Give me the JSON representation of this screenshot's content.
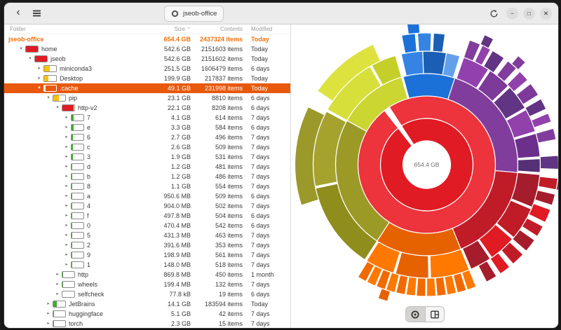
{
  "window": {
    "title": "jseob-office",
    "controls": {
      "back_icon": "‹",
      "minimize_icon": "−",
      "maximize_icon": "□",
      "close_icon": "✕"
    }
  },
  "colors": {
    "selection": "#e8590c",
    "root_text": "#f77009",
    "bar_red": "#e01b24",
    "bar_yellow": "#f5c211",
    "bar_green": "#44a832",
    "bar_white": "#ffffff"
  },
  "tree": {
    "columns": [
      "Folder",
      "Size",
      "Contents",
      "Modified"
    ],
    "sort_caret": "⌃",
    "expander_icons": {
      "open": "▾",
      "closed": "▸",
      "none": ""
    },
    "rows": [
      {
        "name": "jseob-office",
        "level": 0,
        "exp": "none",
        "bar": null,
        "root": true,
        "size": "654.4 GB",
        "contents": "2437324 items",
        "modified": "Today"
      },
      {
        "name": "home",
        "level": 1,
        "exp": "open",
        "bar": {
          "pct": 100,
          "color": "red"
        },
        "size": "542.6 GB",
        "contents": "2151603 items",
        "modified": "Today"
      },
      {
        "name": "jseob",
        "level": 2,
        "exp": "open",
        "bar": {
          "pct": 100,
          "color": "red"
        },
        "size": "542.6 GB",
        "contents": "2151602 items",
        "modified": "Today"
      },
      {
        "name": "miniconda3",
        "level": 3,
        "exp": "closed",
        "bar": {
          "pct": 46,
          "color": "yellow"
        },
        "size": "251.5 GB",
        "contents": "1606479 items",
        "modified": "6 days"
      },
      {
        "name": "Desktop",
        "level": 3,
        "exp": "closed",
        "bar": {
          "pct": 37,
          "color": "yellow"
        },
        "size": "199.9 GB",
        "contents": "217837 items",
        "modified": "Today"
      },
      {
        "name": ".cache",
        "level": 3,
        "exp": "open",
        "bar": {
          "pct": 9,
          "color": "white"
        },
        "sel": true,
        "size": "49.1 GB",
        "contents": "231998 items",
        "modified": "Today"
      },
      {
        "name": "pip",
        "level": 4,
        "exp": "open",
        "bar": {
          "pct": 47,
          "color": "yellow"
        },
        "size": "23.1 GB",
        "contents": "8810 items",
        "modified": "6 days"
      },
      {
        "name": "http-v2",
        "level": 5,
        "exp": "open",
        "bar": {
          "pct": 96,
          "color": "red"
        },
        "size": "22.1 GB",
        "contents": "8208 items",
        "modified": "6 days"
      },
      {
        "name": "7",
        "level": 6,
        "exp": "closed",
        "bar": {
          "pct": 19,
          "color": "green"
        },
        "size": "4.1 GB",
        "contents": "614 items",
        "modified": "7 days"
      },
      {
        "name": "e",
        "level": 6,
        "exp": "closed",
        "bar": {
          "pct": 15,
          "color": "green"
        },
        "size": "3.3 GB",
        "contents": "584 items",
        "modified": "6 days"
      },
      {
        "name": "6",
        "level": 6,
        "exp": "closed",
        "bar": {
          "pct": 12,
          "color": "green"
        },
        "size": "2.7 GB",
        "contents": "496 items",
        "modified": "7 days"
      },
      {
        "name": "c",
        "level": 6,
        "exp": "closed",
        "bar": {
          "pct": 12,
          "color": "green"
        },
        "size": "2.6 GB",
        "contents": "509 items",
        "modified": "7 days"
      },
      {
        "name": "3",
        "level": 6,
        "exp": "closed",
        "bar": {
          "pct": 9,
          "color": "green"
        },
        "size": "1.9 GB",
        "contents": "531 items",
        "modified": "7 days"
      },
      {
        "name": "d",
        "level": 6,
        "exp": "closed",
        "bar": {
          "pct": 5,
          "color": "green"
        },
        "size": "1.2 GB",
        "contents": "481 items",
        "modified": "7 days"
      },
      {
        "name": "b",
        "level": 6,
        "exp": "closed",
        "bar": {
          "pct": 5,
          "color": "green"
        },
        "size": "1.2 GB",
        "contents": "486 items",
        "modified": "7 days"
      },
      {
        "name": "8",
        "level": 6,
        "exp": "closed",
        "bar": {
          "pct": 5,
          "color": "green"
        },
        "size": "1.1 GB",
        "contents": "554 items",
        "modified": "7 days"
      },
      {
        "name": "a",
        "level": 6,
        "exp": "closed",
        "bar": {
          "pct": 4,
          "color": "green"
        },
        "size": "950.6 MB",
        "contents": "509 items",
        "modified": "6 days"
      },
      {
        "name": "4",
        "level": 6,
        "exp": "closed",
        "bar": {
          "pct": 4,
          "color": "green"
        },
        "size": "904.0 MB",
        "contents": "502 items",
        "modified": "7 days"
      },
      {
        "name": "f",
        "level": 6,
        "exp": "closed",
        "bar": {
          "pct": 2,
          "color": "green"
        },
        "size": "497.8 MB",
        "contents": "504 items",
        "modified": "6 days"
      },
      {
        "name": "0",
        "level": 6,
        "exp": "closed",
        "bar": {
          "pct": 2,
          "color": "green"
        },
        "size": "470.4 MB",
        "contents": "542 items",
        "modified": "6 days"
      },
      {
        "name": "5",
        "level": 6,
        "exp": "closed",
        "bar": {
          "pct": 2,
          "color": "green"
        },
        "size": "431.3 MB",
        "contents": "463 items",
        "modified": "7 days"
      },
      {
        "name": "2",
        "level": 6,
        "exp": "closed",
        "bar": {
          "pct": 2,
          "color": "green"
        },
        "size": "391.6 MB",
        "contents": "353 items",
        "modified": "7 days"
      },
      {
        "name": "9",
        "level": 6,
        "exp": "closed",
        "bar": {
          "pct": 1,
          "color": "green"
        },
        "size": "198.9 MB",
        "contents": "561 items",
        "modified": "7 days"
      },
      {
        "name": "1",
        "level": 6,
        "exp": "closed",
        "bar": {
          "pct": 1,
          "color": "green"
        },
        "size": "148.0 MB",
        "contents": "518 items",
        "modified": "7 days"
      },
      {
        "name": "http",
        "level": 5,
        "exp": "closed",
        "bar": {
          "pct": 4,
          "color": "green"
        },
        "size": "869.8 MB",
        "contents": "450 items",
        "modified": "1 month"
      },
      {
        "name": "wheels",
        "level": 5,
        "exp": "closed",
        "bar": {
          "pct": 1,
          "color": "green"
        },
        "size": "199.4 MB",
        "contents": "132 items",
        "modified": "7 days"
      },
      {
        "name": "selfcheck",
        "level": 5,
        "exp": "closed",
        "bar": {
          "pct": 0,
          "color": "green"
        },
        "size": "77.8 kB",
        "contents": "19 items",
        "modified": "6 days"
      },
      {
        "name": "JetBrains",
        "level": 4,
        "exp": "closed",
        "bar": {
          "pct": 30,
          "color": "green"
        },
        "size": "14.1 GB",
        "contents": "183594 items",
        "modified": "Today"
      },
      {
        "name": "huggingface",
        "level": 4,
        "exp": "closed",
        "bar": {
          "pct": 1,
          "color": "green"
        },
        "size": "5.1 GB",
        "contents": "42 items",
        "modified": "7 days"
      },
      {
        "name": "torch",
        "level": 4,
        "exp": "closed",
        "bar": {
          "pct": 1,
          "color": "green"
        },
        "size": "2.3 GB",
        "contents": "15 items",
        "modified": "7 days"
      }
    ]
  },
  "chart": {
    "type": "sunburst",
    "center_label": "654.4 GB",
    "arcs": [
      {
        "r": 1,
        "s": 327,
        "e": 682,
        "c": "#e01b24"
      },
      {
        "r": 2,
        "s": 327,
        "e": 682,
        "c": "#ed333b"
      },
      {
        "r": 3,
        "s": 345,
        "e": 378,
        "c": "#1c71d8"
      },
      {
        "r": 3,
        "s": 18,
        "e": 95,
        "c": "#813d9c"
      },
      {
        "r": 3,
        "s": 95,
        "e": 158,
        "c": "#c01c28"
      },
      {
        "r": 3,
        "s": 158,
        "e": 213,
        "c": "#e66100"
      },
      {
        "r": 3,
        "s": 213,
        "e": 299,
        "c": "#9c9a26"
      },
      {
        "r": 3,
        "s": 299,
        "e": 344,
        "c": "#ccd633"
      },
      {
        "r": 4,
        "s": 347,
        "e": 358,
        "c": "#3584e4"
      },
      {
        "r": 4,
        "s": 358,
        "e": 370,
        "c": "#1a5fb4"
      },
      {
        "r": 4,
        "s": 10,
        "e": 17,
        "c": "#62a0ea"
      },
      {
        "r": 4,
        "s": 19,
        "e": 33,
        "c": "#9141ac"
      },
      {
        "r": 4,
        "s": 34,
        "e": 46,
        "c": "#7d3a99"
      },
      {
        "r": 4,
        "s": 47,
        "e": 60,
        "c": "#613583"
      },
      {
        "r": 4,
        "s": 61,
        "e": 73,
        "c": "#9141ac"
      },
      {
        "r": 4,
        "s": 74,
        "e": 86,
        "c": "#6d2f8c"
      },
      {
        "r": 4,
        "s": 87,
        "e": 94,
        "c": "#553077"
      },
      {
        "r": 4,
        "s": 95,
        "e": 112,
        "c": "#a51d2d"
      },
      {
        "r": 4,
        "s": 113,
        "e": 130,
        "c": "#c01c28"
      },
      {
        "r": 4,
        "s": 131,
        "e": 145,
        "c": "#e01b24"
      },
      {
        "r": 4,
        "s": 146,
        "e": 157,
        "c": "#a51d2d"
      },
      {
        "r": 4,
        "s": 158,
        "e": 178,
        "c": "#ff7800"
      },
      {
        "r": 4,
        "s": 179,
        "e": 196,
        "c": "#e66100"
      },
      {
        "r": 4,
        "s": 197,
        "e": 212,
        "c": "#ff7800"
      },
      {
        "r": 4,
        "s": 213,
        "e": 258,
        "c": "#8f8d1c"
      },
      {
        "r": 4,
        "s": 259,
        "e": 298,
        "c": "#a5a32e"
      },
      {
        "r": 4,
        "s": 299,
        "e": 330,
        "c": "#d7df3b"
      },
      {
        "r": 4,
        "s": 331,
        "e": 344,
        "c": "#c5cf2a"
      },
      {
        "r": 5,
        "s": 349,
        "e": 355,
        "c": "#1c71d8"
      },
      {
        "r": 5,
        "s": 356,
        "e": 362,
        "c": "#3584e4"
      },
      {
        "r": 5,
        "s": 3,
        "e": 8,
        "c": "#1a5fb4"
      },
      {
        "r": 5,
        "s": 19,
        "e": 24,
        "c": "#813d9c"
      },
      {
        "r": 5,
        "s": 25,
        "e": 29,
        "c": "#9141ac"
      },
      {
        "r": 5,
        "s": 30,
        "e": 36,
        "c": "#613583"
      },
      {
        "r": 5,
        "s": 38,
        "e": 43,
        "c": "#813d9c"
      },
      {
        "r": 5,
        "s": 45,
        "e": 50,
        "c": "#9141ac"
      },
      {
        "r": 5,
        "s": 52,
        "e": 58,
        "c": "#7d3a99"
      },
      {
        "r": 5,
        "s": 60,
        "e": 65,
        "c": "#613583"
      },
      {
        "r": 5,
        "s": 67,
        "e": 71,
        "c": "#9141ac"
      },
      {
        "r": 5,
        "s": 74,
        "e": 79,
        "c": "#813d9c"
      },
      {
        "r": 5,
        "s": 86,
        "e": 92,
        "c": "#613583"
      },
      {
        "r": 5,
        "s": 96,
        "e": 101,
        "c": "#c01c28"
      },
      {
        "r": 5,
        "s": 103,
        "e": 108,
        "c": "#a51d2d"
      },
      {
        "r": 5,
        "s": 110,
        "e": 116,
        "c": "#e01b24"
      },
      {
        "r": 5,
        "s": 118,
        "e": 123,
        "c": "#c01c28"
      },
      {
        "r": 5,
        "s": 125,
        "e": 131,
        "c": "#a51d2d"
      },
      {
        "r": 5,
        "s": 133,
        "e": 139,
        "c": "#c01c28"
      },
      {
        "r": 5,
        "s": 141,
        "e": 146,
        "c": "#e01b24"
      },
      {
        "r": 5,
        "s": 148,
        "e": 153,
        "c": "#a51d2d"
      },
      {
        "r": 5,
        "s": 158,
        "e": 162,
        "c": "#ff7800"
      },
      {
        "r": 5,
        "s": 162.5,
        "e": 166.5,
        "c": "#f06a00"
      },
      {
        "r": 5,
        "s": 167,
        "e": 171,
        "c": "#ff7800"
      },
      {
        "r": 5,
        "s": 171.5,
        "e": 175.5,
        "c": "#f06a00"
      },
      {
        "r": 5,
        "s": 176,
        "e": 180,
        "c": "#ff7800"
      },
      {
        "r": 5,
        "s": 180.5,
        "e": 184.5,
        "c": "#f06a00"
      },
      {
        "r": 5,
        "s": 185,
        "e": 189,
        "c": "#ff7800"
      },
      {
        "r": 5,
        "s": 189.5,
        "e": 193.5,
        "c": "#f06a00"
      },
      {
        "r": 5,
        "s": 194,
        "e": 198,
        "c": "#ff7800"
      },
      {
        "r": 5,
        "s": 198.5,
        "e": 202.5,
        "c": "#f06a00"
      },
      {
        "r": 5,
        "s": 203,
        "e": 207,
        "c": "#ff7800"
      },
      {
        "r": 5,
        "s": 207.5,
        "e": 211.5,
        "c": "#f06a00"
      },
      {
        "r": 5,
        "s": 252,
        "e": 296,
        "c": "#9b992a"
      },
      {
        "r": 5,
        "s": 304,
        "e": 336,
        "c": "#dde23f"
      },
      {
        "r": 6,
        "s": 24,
        "e": 28,
        "c": "#613583"
      },
      {
        "r": 6,
        "s": 40,
        "e": 44,
        "c": "#813d9c"
      },
      {
        "r": 6,
        "s": 97,
        "e": 101,
        "c": "#a51d2d"
      },
      {
        "r": 6,
        "s": 196,
        "e": 200,
        "c": "#e66100"
      },
      {
        "r": 6,
        "s": 352,
        "e": 357,
        "c": "#1c71d8"
      }
    ]
  }
}
